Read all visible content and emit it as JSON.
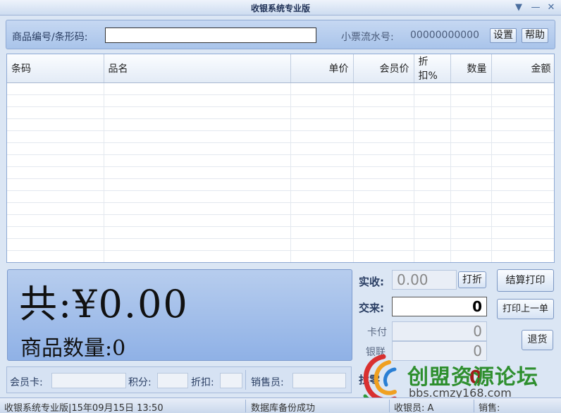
{
  "window": {
    "title": "收银系统专业版"
  },
  "toolbar": {
    "barcode_label": "商品编号/条形码:",
    "barcode_value": "",
    "serial_label": "小票流水号:",
    "serial_value": "00000000000",
    "settings_label": "设置",
    "help_label": "帮助"
  },
  "table": {
    "columns": [
      "条码",
      "品名",
      "单价",
      "会员价",
      "折扣%",
      "数量",
      "金额"
    ],
    "rows": []
  },
  "summary": {
    "total_text": "共:¥0.00",
    "count_text": "商品数量:0"
  },
  "payment": {
    "actual_label": "实收:",
    "actual_value": "0.00",
    "discount_button": "打折",
    "tendered_label": "交来:",
    "tendered_value": "0",
    "card_label": "卡付",
    "card_value": "0",
    "unionpay_label": "银联",
    "unionpay_value": "0",
    "change_label": "找零",
    "change_value": "0"
  },
  "actions": {
    "settle_print": "结算打印",
    "print_last": "打印上一单",
    "refund": "退货"
  },
  "member": {
    "card_label": "会员卡:",
    "points_label": "积分:",
    "discount_label": "折扣:",
    "salesperson_label": "销售员:"
  },
  "status": {
    "app_datetime": "收银系统专业版|15年09月15日 13:50",
    "message": "数据库备份成功",
    "cashier": "收银员: A",
    "sales": "销售:"
  },
  "watermark": {
    "brand": "创盟资源论坛",
    "url": "bbs.cmzy168.com"
  }
}
